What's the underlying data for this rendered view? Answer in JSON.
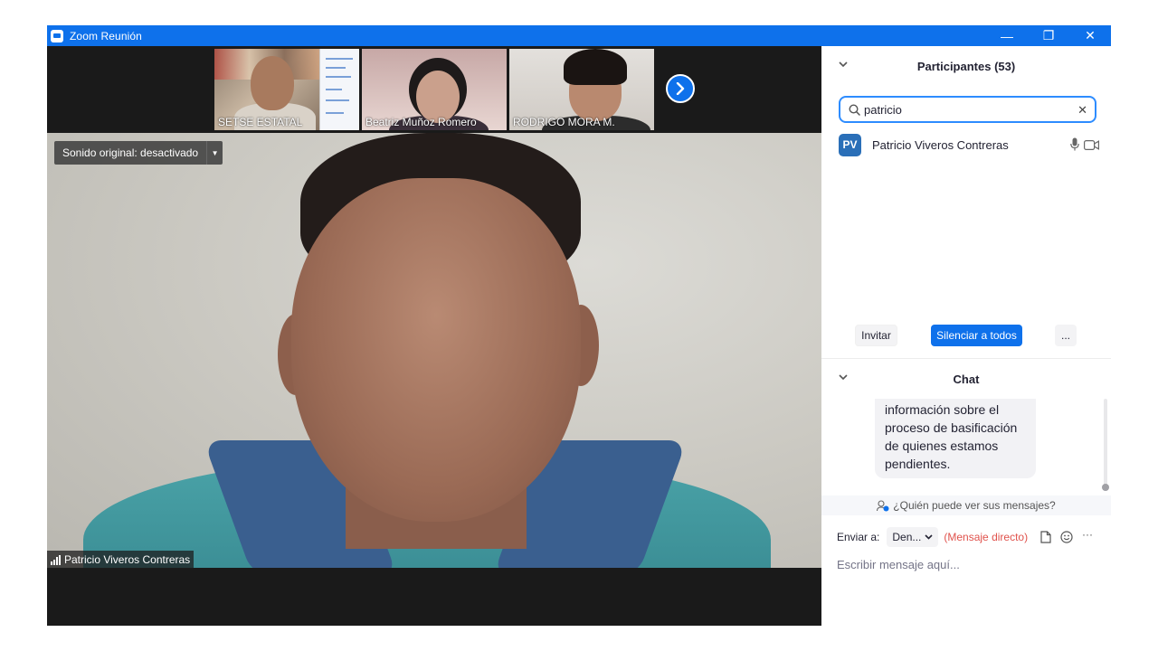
{
  "window": {
    "title": "Zoom Reunión",
    "minimize_label": "—",
    "restore_label": "❐",
    "close_label": "✕"
  },
  "thumbnails": [
    {
      "name": "SETSE ESTATAL"
    },
    {
      "name": "Beatriz Muñoz Romero"
    },
    {
      "name": "RODRIGO MORA M."
    }
  ],
  "main_video": {
    "sound_toggle_label": "Sonido original: desactivado",
    "speaker_name": "Patricio Viveros Contreras"
  },
  "participants": {
    "header": "Participantes (53)",
    "search_value": "patricio",
    "list": [
      {
        "initials": "PV",
        "name": "Patricio Viveros Contreras"
      }
    ],
    "invite_label": "Invitar",
    "mute_all_label": "Silenciar a todos",
    "more_label": "..."
  },
  "chat": {
    "header": "Chat",
    "message_text": "información sobre el proceso de basificación de quienes estamos pendientes.",
    "privacy_note": "¿Quién puede ver sus mensajes?",
    "send_to_label": "Enviar a:",
    "recipient": "Den...",
    "direct_label": "(Mensaje directo)",
    "more_label": "···",
    "input_placeholder": "Escribir mensaje aquí..."
  },
  "colors": {
    "brand_blue": "#0e71eb",
    "focus_blue": "#2d8cff",
    "direct_red": "#e0524c"
  }
}
